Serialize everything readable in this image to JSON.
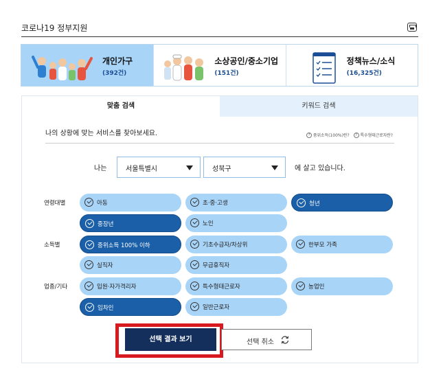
{
  "page": {
    "title": "코로나19 정부지원"
  },
  "categories": [
    {
      "name": "개인가구",
      "count": "(392건)",
      "active": true
    },
    {
      "name": "소상공인/중소기업",
      "count": "(151건)",
      "active": false
    },
    {
      "name": "정책뉴스/소식",
      "count": "(16,325건)",
      "active": false
    }
  ],
  "tabs": [
    {
      "label": "맞춤 검색",
      "active": true
    },
    {
      "label": "키워드 검색",
      "active": false
    }
  ],
  "search": {
    "intro": "나의 상황에 맞는 서비스를 찾아보세요.",
    "help_links": [
      "중위소득(100%)란?",
      "특수형태근로자란?"
    ],
    "location_prefix": "나는",
    "city": "서울특별시",
    "district": "성북구",
    "location_suffix": "에 살고 있습니다."
  },
  "filters": {
    "age": {
      "label": "연령대별",
      "options": [
        {
          "label": "아동",
          "selected": false
        },
        {
          "label": "초·중·고생",
          "selected": false
        },
        {
          "label": "청년",
          "selected": true
        },
        {
          "label": "중장년",
          "selected": true
        },
        {
          "label": "노인",
          "selected": false
        }
      ]
    },
    "income": {
      "label": "소득별",
      "options": [
        {
          "label": "중위소득 100% 이하",
          "selected": true
        },
        {
          "label": "기초수급자/차상위",
          "selected": false
        },
        {
          "label": "한부모 가족",
          "selected": false
        },
        {
          "label": "실직자",
          "selected": false
        },
        {
          "label": "무급휴직자",
          "selected": false
        }
      ]
    },
    "job": {
      "label": "업종/기타",
      "options": [
        {
          "label": "입원·자가격리자",
          "selected": false
        },
        {
          "label": "특수형태근로자",
          "selected": false
        },
        {
          "label": "농업인",
          "selected": false
        },
        {
          "label": "임차인",
          "selected": true
        },
        {
          "label": "일반근로자",
          "selected": false
        }
      ]
    }
  },
  "actions": {
    "view_results": "선택 결과 보기",
    "cancel": "선택 취소"
  },
  "colors": {
    "pill": "#a8d4f8",
    "pill_selected": "#1a5fa8",
    "primary_button": "#142f5c",
    "highlight": "#d71920",
    "count_text": "#1a4d96"
  }
}
